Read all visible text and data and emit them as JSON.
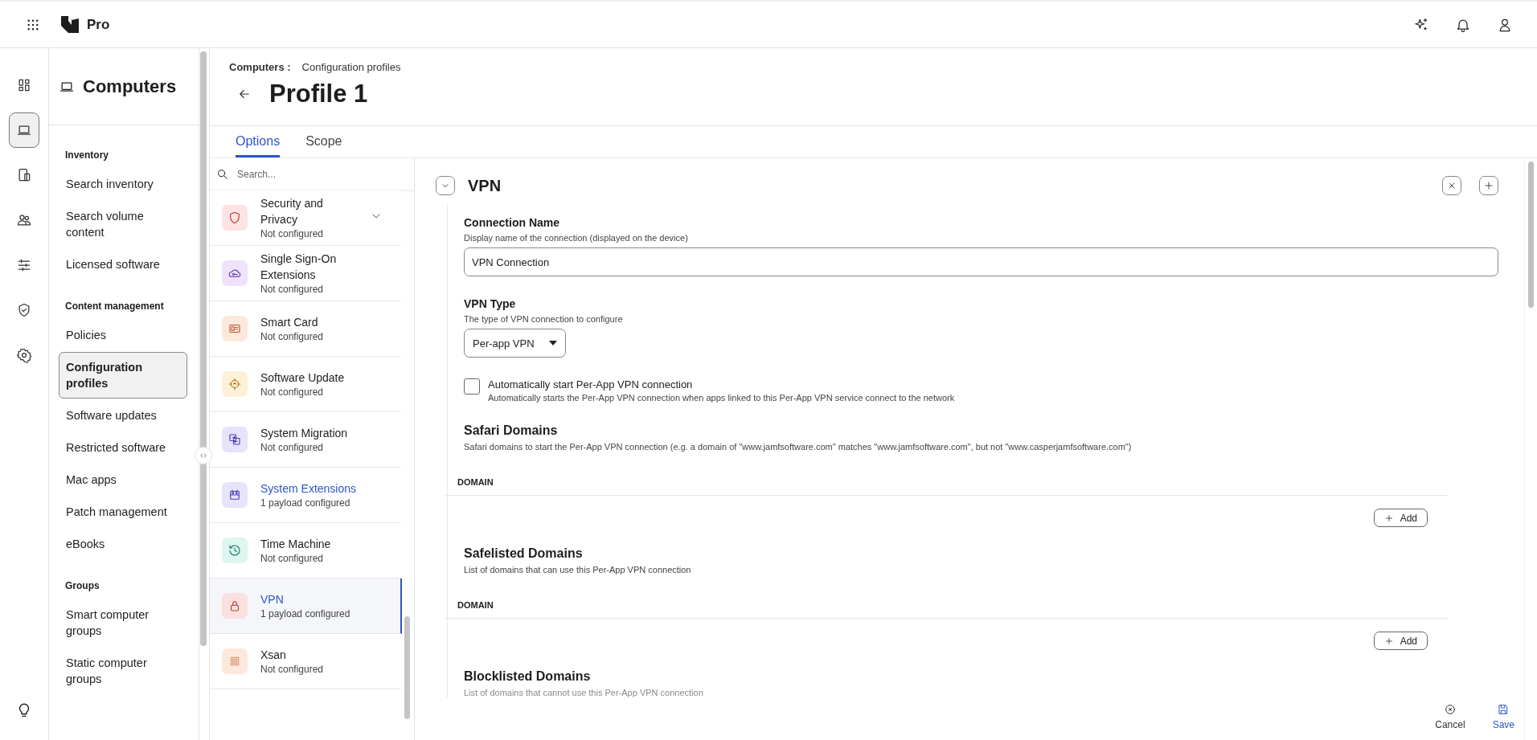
{
  "topbar": {
    "product": "Pro"
  },
  "rail": [
    {
      "selected": false
    },
    {
      "selected": true
    },
    {
      "selected": false
    },
    {
      "selected": false
    },
    {
      "selected": false
    },
    {
      "selected": false
    },
    {
      "selected": false
    }
  ],
  "sidebar": {
    "title": "Computers",
    "sections": [
      {
        "heading": "Inventory",
        "items": [
          {
            "label": "Search inventory",
            "selected": false
          },
          {
            "label": "Search volume content",
            "selected": false
          },
          {
            "label": "Licensed software",
            "selected": false
          }
        ]
      },
      {
        "heading": "Content management",
        "items": [
          {
            "label": "Policies",
            "selected": false
          },
          {
            "label": "Configuration profiles",
            "selected": true
          },
          {
            "label": "Software updates",
            "selected": false
          },
          {
            "label": "Restricted software",
            "selected": false
          },
          {
            "label": "Mac apps",
            "selected": false
          },
          {
            "label": "Patch management",
            "selected": false
          },
          {
            "label": "eBooks",
            "selected": false
          }
        ]
      },
      {
        "heading": "Groups",
        "items": [
          {
            "label": "Smart computer groups",
            "selected": false
          },
          {
            "label": "Static computer groups",
            "selected": false
          }
        ]
      }
    ]
  },
  "breadcrumb": {
    "parent": "Computers",
    "separator": ":",
    "current": "Configuration profiles"
  },
  "title": "Profile 1",
  "tabs": [
    {
      "label": "Options",
      "selected": true
    },
    {
      "label": "Scope",
      "selected": false
    }
  ],
  "payload_search": {
    "placeholder": "Search..."
  },
  "payloads": [
    {
      "title": "Security and Privacy",
      "status": "Not configured",
      "configured": false,
      "selected": false,
      "kind": "group",
      "expanded": false
    },
    {
      "title": "Single Sign-On Extensions",
      "status": "Not configured",
      "configured": false,
      "selected": false,
      "kind": "payload"
    },
    {
      "title": "Smart Card",
      "status": "Not configured",
      "configured": false,
      "selected": false,
      "kind": "payload"
    },
    {
      "title": "Software Update",
      "status": "Not configured",
      "configured": false,
      "selected": false,
      "kind": "payload"
    },
    {
      "title": "System Migration",
      "status": "Not configured",
      "configured": false,
      "selected": false,
      "kind": "payload"
    },
    {
      "title": "System Extensions",
      "status": "1 payload configured",
      "configured": true,
      "selected": false,
      "kind": "payload"
    },
    {
      "title": "Time Machine",
      "status": "Not configured",
      "configured": false,
      "selected": false,
      "kind": "payload"
    },
    {
      "title": "VPN",
      "status": "1 payload configured",
      "configured": true,
      "selected": true,
      "kind": "payload"
    },
    {
      "title": "Xsan",
      "status": "Not configured",
      "configured": false,
      "selected": false,
      "kind": "payload"
    }
  ],
  "section": {
    "title": "VPN",
    "expanded": true
  },
  "connection_name": {
    "label": "Connection Name",
    "description": "Display name of the connection (displayed on the device)",
    "value": "VPN Connection"
  },
  "vpn_type": {
    "label": "VPN Type",
    "description": "The type of VPN connection to configure",
    "value": "Per-app VPN"
  },
  "auto_start": {
    "label": "Automatically start Per-App VPN connection",
    "description": "Automatically starts the Per-App VPN connection when apps linked to this Per-App VPN service connect to the network",
    "checked": false
  },
  "domain_lists": [
    {
      "title": "Safari Domains",
      "description": "Safari domains to start the Per-App VPN connection (e.g. a domain of \"www.jamfsoftware.com\" matches \"www.jamfsoftware.com\", but not \"www.casperjamfsoftware.com\")",
      "column": "DOMAIN",
      "add": "Add"
    },
    {
      "title": "Safelisted Domains",
      "description": "List of domains that can use this Per-App VPN connection",
      "column": "DOMAIN",
      "add": "Add"
    },
    {
      "title": "Blocklisted Domains",
      "description": "List of domains that cannot use this Per-App VPN connection"
    }
  ],
  "actions": {
    "cancel": "Cancel",
    "save": "Save"
  }
}
